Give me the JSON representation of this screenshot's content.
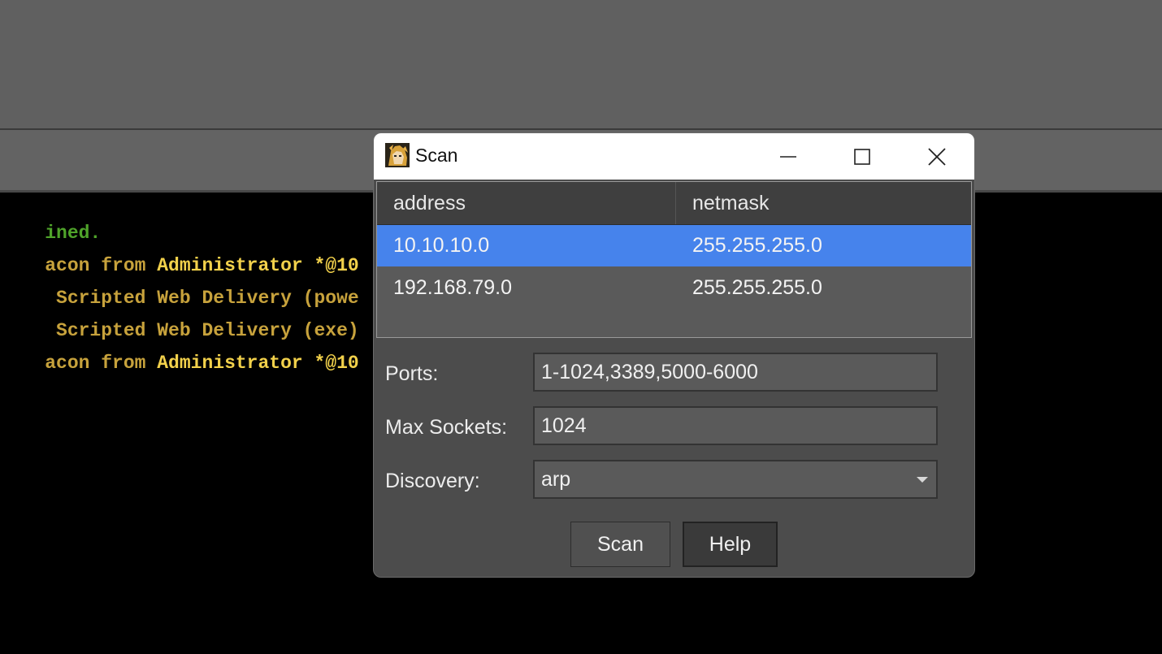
{
  "console": {
    "lines": [
      {
        "parts": [
          {
            "text": "ined.",
            "cls": "c-green"
          }
        ]
      },
      {
        "parts": [
          {
            "text": "acon from ",
            "cls": "c-olive"
          },
          {
            "text": "Administrator *@10",
            "cls": "c-yellow"
          }
        ]
      },
      {
        "parts": [
          {
            "text": " Scripted Web Delivery (powe",
            "cls": "c-olive"
          }
        ]
      },
      {
        "parts": [
          {
            "text": " Scripted Web Delivery (exe)",
            "cls": "c-olive"
          }
        ]
      },
      {
        "parts": [
          {
            "text": "acon from ",
            "cls": "c-olive"
          },
          {
            "text": "Administrator *@10",
            "cls": "c-yellow"
          }
        ]
      }
    ]
  },
  "dialog": {
    "title": "Scan",
    "table": {
      "columns": [
        "address",
        "netmask"
      ],
      "rows": [
        {
          "address": "10.10.10.0",
          "netmask": "255.255.255.0",
          "selected": true
        },
        {
          "address": "192.168.79.0",
          "netmask": "255.255.255.0",
          "selected": false
        }
      ]
    },
    "form": {
      "ports_label": "Ports:",
      "ports_value": "1-1024,3389,5000-6000",
      "max_sockets_label": "Max Sockets:",
      "max_sockets_value": "1024",
      "discovery_label": "Discovery:",
      "discovery_value": "arp"
    },
    "buttons": {
      "scan": "Scan",
      "help": "Help"
    }
  },
  "colors": {
    "selection": "#4683ec",
    "console_green": "#4fa32a",
    "console_olive": "#c7a23c",
    "console_yellow": "#f2d14b"
  }
}
